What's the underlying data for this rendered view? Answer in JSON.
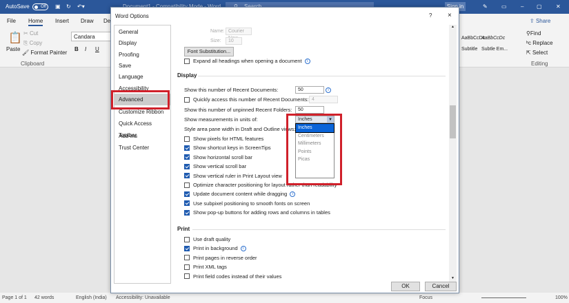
{
  "titlebar": {
    "autosave": "AutoSave",
    "toggle": "Off",
    "doc_title": "Document1 - Compatibility Mode - Word",
    "search": "Search",
    "signin": "Sign in"
  },
  "ribbon": {
    "tabs": [
      "File",
      "Home",
      "Insert",
      "Draw",
      "De"
    ],
    "font": "Candara",
    "paste": "Paste",
    "cut": "Cut",
    "copy": "Copy",
    "format_painter": "Format Painter",
    "clipboard": "Clipboard",
    "styles": [
      "AaBbCcDc",
      "AaBbCcDc"
    ],
    "style_names": [
      "Subtitle",
      "Subtle Em..."
    ],
    "share": "Share",
    "find": "Find",
    "replace": "Replace",
    "select": "Select",
    "editing": "Editing"
  },
  "dialog": {
    "title": "Word Options",
    "help": "?",
    "close": "×",
    "nav": [
      "General",
      "Display",
      "Proofing",
      "Save",
      "Language",
      "Accessibility",
      "Advanced",
      "Customize Ribbon",
      "Quick Access Toolbar",
      "Add-ins",
      "Trust Center"
    ],
    "selected_nav": "Advanced",
    "font_name_label": "Name:",
    "font_name": "Courier New",
    "size_label": "Size:",
    "size": "10",
    "font_sub": "Font Substitution...",
    "expand_headings": "Expand all headings when opening a document",
    "display_section": "Display",
    "recent_docs_label": "Show this number of Recent Documents:",
    "recent_docs": "50",
    "quick_access_label": "Quickly access this number of Recent Documents:",
    "quick_access": "4",
    "recent_folders_label": "Show this number of unpinned Recent Folders:",
    "recent_folders": "50",
    "units_label": "Show measurements in units of:",
    "units_value": "Inches",
    "units_options": [
      "Inches",
      "Centimeters",
      "Millimeters",
      "Points",
      "Picas"
    ],
    "style_area_label": "Style area pane width in Draft and Outline views:",
    "checks": [
      {
        "label": "Show pixels for HTML features",
        "checked": false
      },
      {
        "label": "Show shortcut keys in ScreenTips",
        "checked": true
      },
      {
        "label": "Show horizontal scroll bar",
        "checked": true
      },
      {
        "label": "Show vertical scroll bar",
        "checked": true
      },
      {
        "label": "Show vertical ruler in Print Layout view",
        "checked": true
      },
      {
        "label": "Optimize character positioning for layout rather than readability",
        "checked": false
      },
      {
        "label": "Update document content while dragging",
        "checked": true
      },
      {
        "label": "Use subpixel positioning to smooth fonts on screen",
        "checked": true
      },
      {
        "label": "Show pop-up buttons for adding rows and columns in tables",
        "checked": true
      }
    ],
    "print_section": "Print",
    "print_checks": [
      {
        "label": "Use draft quality",
        "checked": false
      },
      {
        "label": "Print in background",
        "checked": true
      },
      {
        "label": "Print pages in reverse order",
        "checked": false
      },
      {
        "label": "Print XML tags",
        "checked": false
      },
      {
        "label": "Print field codes instead of their values",
        "checked": false
      }
    ],
    "ok": "OK",
    "cancel": "Cancel"
  },
  "status": {
    "page": "Page 1 of 1",
    "words": "42 words",
    "language": "English (India)",
    "accessibility": "Accessibility: Unavailable",
    "focus": "Focus",
    "zoom": "100%"
  }
}
